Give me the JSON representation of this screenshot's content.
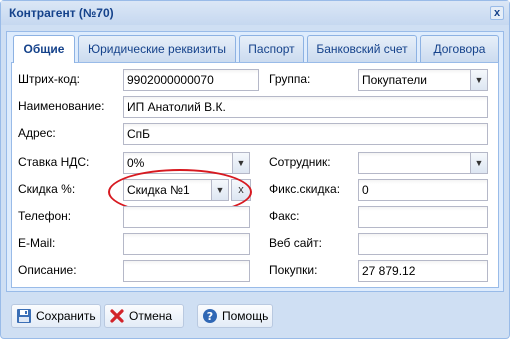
{
  "window": {
    "title": "Контрагент (№70)",
    "close_label": "x"
  },
  "tabs": [
    {
      "label": "Общие",
      "active": true
    },
    {
      "label": "Юридические реквизиты",
      "active": false
    },
    {
      "label": "Паспорт",
      "active": false
    },
    {
      "label": "Банковский счет",
      "active": false
    },
    {
      "label": "Договора",
      "active": false
    }
  ],
  "form": {
    "barcode": {
      "label": "Штрих-код:",
      "value": "9902000000070"
    },
    "group": {
      "label": "Группа:",
      "value": "Покупатели"
    },
    "name": {
      "label": "Наименование:",
      "value": "ИП Анатолий В.К."
    },
    "address": {
      "label": "Адрес:",
      "value": "СпБ"
    },
    "vat": {
      "label": "Ставка НДС:",
      "value": "0%"
    },
    "employee": {
      "label": "Сотрудник:",
      "value": ""
    },
    "discount": {
      "label": "Скидка %:",
      "value": "Скидка №1",
      "clear_label": "x"
    },
    "fixed_discount": {
      "label": "Фикс.скидка:",
      "value": "0"
    },
    "phone": {
      "label": "Телефон:",
      "value": ""
    },
    "fax": {
      "label": "Факс:",
      "value": ""
    },
    "email": {
      "label": "E-Mail:",
      "value": ""
    },
    "website": {
      "label": "Веб сайт:",
      "value": ""
    },
    "description": {
      "label": "Описание:",
      "value": ""
    },
    "purchases": {
      "label": "Покупки:",
      "value": "27 879.12"
    }
  },
  "buttons": {
    "save": "Сохранить",
    "cancel": "Отмена",
    "help": "Помощь"
  },
  "colors": {
    "highlight_ellipse": "#d71920",
    "title_text": "#15428b",
    "window_bg": "#cfdff3"
  },
  "icons": {
    "save": "floppy-disk-icon",
    "cancel": "red-x-icon",
    "help": "question-circle-icon",
    "combo": "chevron-down-icon"
  }
}
